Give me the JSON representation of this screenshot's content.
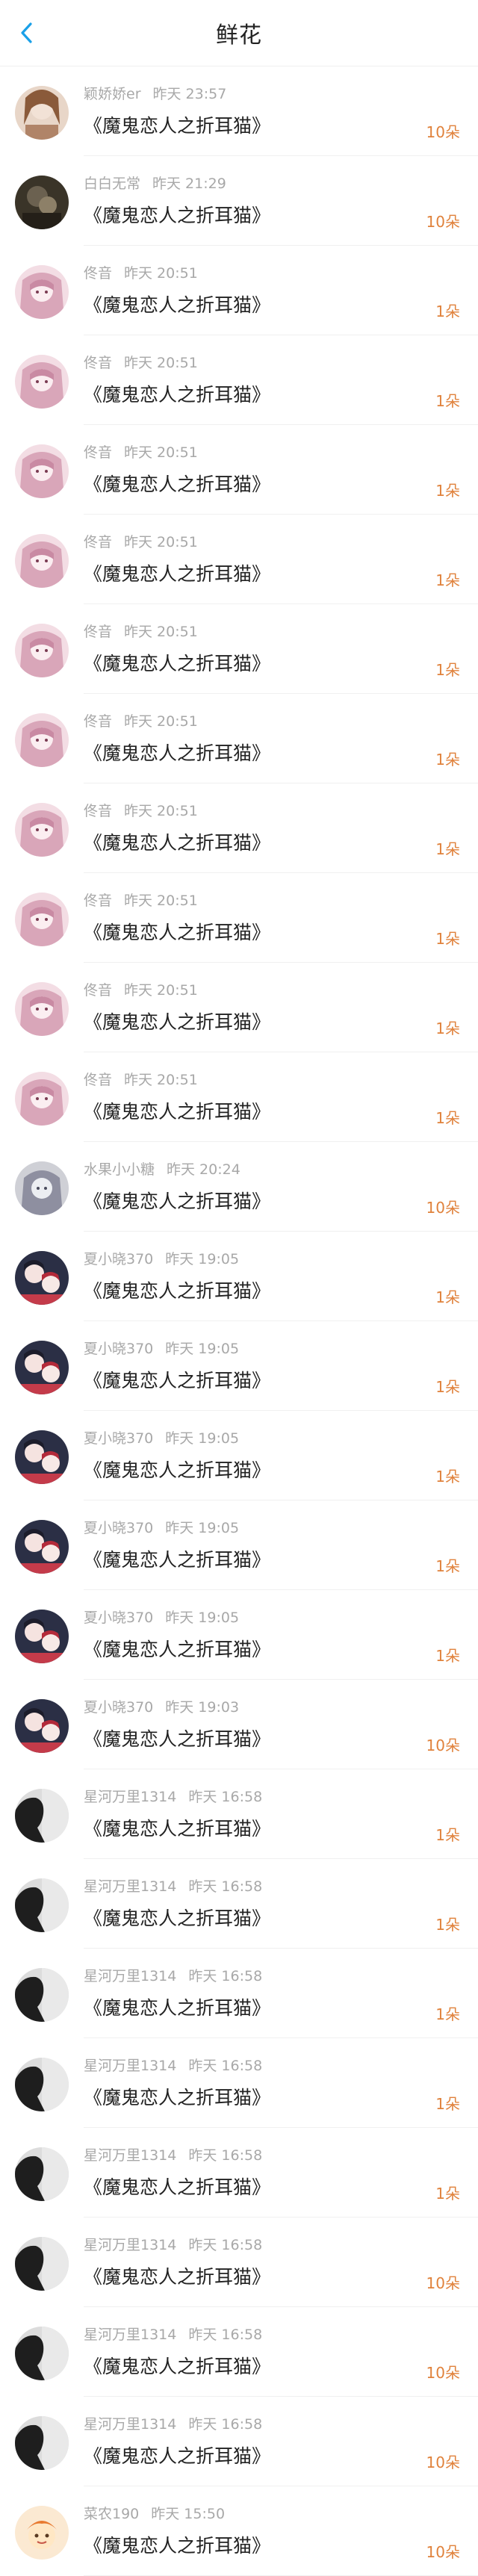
{
  "header": {
    "title": "鲜花"
  },
  "colors": {
    "accent": "#1aa0e8",
    "count": "#e0823c"
  },
  "rows": [
    {
      "user": "颖娇娇er",
      "time": "昨天 23:57",
      "book": "《魔鬼恋人之折耳猫》",
      "count": "10朵",
      "avatar": "avatar-brown"
    },
    {
      "user": "白白无常",
      "time": "昨天 21:29",
      "book": "《魔鬼恋人之折耳猫》",
      "count": "10朵",
      "avatar": "avatar-dark"
    },
    {
      "user": "佟音",
      "time": "昨天 20:51",
      "book": "《魔鬼恋人之折耳猫》",
      "count": "1朵",
      "avatar": "avatar-pink"
    },
    {
      "user": "佟音",
      "time": "昨天 20:51",
      "book": "《魔鬼恋人之折耳猫》",
      "count": "1朵",
      "avatar": "avatar-pink"
    },
    {
      "user": "佟音",
      "time": "昨天 20:51",
      "book": "《魔鬼恋人之折耳猫》",
      "count": "1朵",
      "avatar": "avatar-pink"
    },
    {
      "user": "佟音",
      "time": "昨天 20:51",
      "book": "《魔鬼恋人之折耳猫》",
      "count": "1朵",
      "avatar": "avatar-pink"
    },
    {
      "user": "佟音",
      "time": "昨天 20:51",
      "book": "《魔鬼恋人之折耳猫》",
      "count": "1朵",
      "avatar": "avatar-pink"
    },
    {
      "user": "佟音",
      "time": "昨天 20:51",
      "book": "《魔鬼恋人之折耳猫》",
      "count": "1朵",
      "avatar": "avatar-pink"
    },
    {
      "user": "佟音",
      "time": "昨天 20:51",
      "book": "《魔鬼恋人之折耳猫》",
      "count": "1朵",
      "avatar": "avatar-pink"
    },
    {
      "user": "佟音",
      "time": "昨天 20:51",
      "book": "《魔鬼恋人之折耳猫》",
      "count": "1朵",
      "avatar": "avatar-pink"
    },
    {
      "user": "佟音",
      "time": "昨天 20:51",
      "book": "《魔鬼恋人之折耳猫》",
      "count": "1朵",
      "avatar": "avatar-pink"
    },
    {
      "user": "佟音",
      "time": "昨天 20:51",
      "book": "《魔鬼恋人之折耳猫》",
      "count": "1朵",
      "avatar": "avatar-pink"
    },
    {
      "user": "水果小小糖",
      "time": "昨天 20:24",
      "book": "《魔鬼恋人之折耳猫》",
      "count": "10朵",
      "avatar": "avatar-gray"
    },
    {
      "user": "夏小晓370",
      "time": "昨天 19:05",
      "book": "《魔鬼恋人之折耳猫》",
      "count": "1朵",
      "avatar": "avatar-anime"
    },
    {
      "user": "夏小晓370",
      "time": "昨天 19:05",
      "book": "《魔鬼恋人之折耳猫》",
      "count": "1朵",
      "avatar": "avatar-anime"
    },
    {
      "user": "夏小晓370",
      "time": "昨天 19:05",
      "book": "《魔鬼恋人之折耳猫》",
      "count": "1朵",
      "avatar": "avatar-anime"
    },
    {
      "user": "夏小晓370",
      "time": "昨天 19:05",
      "book": "《魔鬼恋人之折耳猫》",
      "count": "1朵",
      "avatar": "avatar-anime"
    },
    {
      "user": "夏小晓370",
      "time": "昨天 19:05",
      "book": "《魔鬼恋人之折耳猫》",
      "count": "1朵",
      "avatar": "avatar-anime"
    },
    {
      "user": "夏小晓370",
      "time": "昨天 19:03",
      "book": "《魔鬼恋人之折耳猫》",
      "count": "10朵",
      "avatar": "avatar-anime"
    },
    {
      "user": "星河万里1314",
      "time": "昨天 16:58",
      "book": "《魔鬼恋人之折耳猫》",
      "count": "1朵",
      "avatar": "avatar-silhouette"
    },
    {
      "user": "星河万里1314",
      "time": "昨天 16:58",
      "book": "《魔鬼恋人之折耳猫》",
      "count": "1朵",
      "avatar": "avatar-silhouette"
    },
    {
      "user": "星河万里1314",
      "time": "昨天 16:58",
      "book": "《魔鬼恋人之折耳猫》",
      "count": "1朵",
      "avatar": "avatar-silhouette"
    },
    {
      "user": "星河万里1314",
      "time": "昨天 16:58",
      "book": "《魔鬼恋人之折耳猫》",
      "count": "1朵",
      "avatar": "avatar-silhouette"
    },
    {
      "user": "星河万里1314",
      "time": "昨天 16:58",
      "book": "《魔鬼恋人之折耳猫》",
      "count": "1朵",
      "avatar": "avatar-silhouette"
    },
    {
      "user": "星河万里1314",
      "time": "昨天 16:58",
      "book": "《魔鬼恋人之折耳猫》",
      "count": "10朵",
      "avatar": "avatar-silhouette"
    },
    {
      "user": "星河万里1314",
      "time": "昨天 16:58",
      "book": "《魔鬼恋人之折耳猫》",
      "count": "10朵",
      "avatar": "avatar-silhouette"
    },
    {
      "user": "星河万里1314",
      "time": "昨天 16:58",
      "book": "《魔鬼恋人之折耳猫》",
      "count": "10朵",
      "avatar": "avatar-silhouette"
    },
    {
      "user": "菜农190",
      "time": "昨天 15:50",
      "book": "《魔鬼恋人之折耳猫》",
      "count": "10朵",
      "avatar": "avatar-cartoon"
    }
  ]
}
